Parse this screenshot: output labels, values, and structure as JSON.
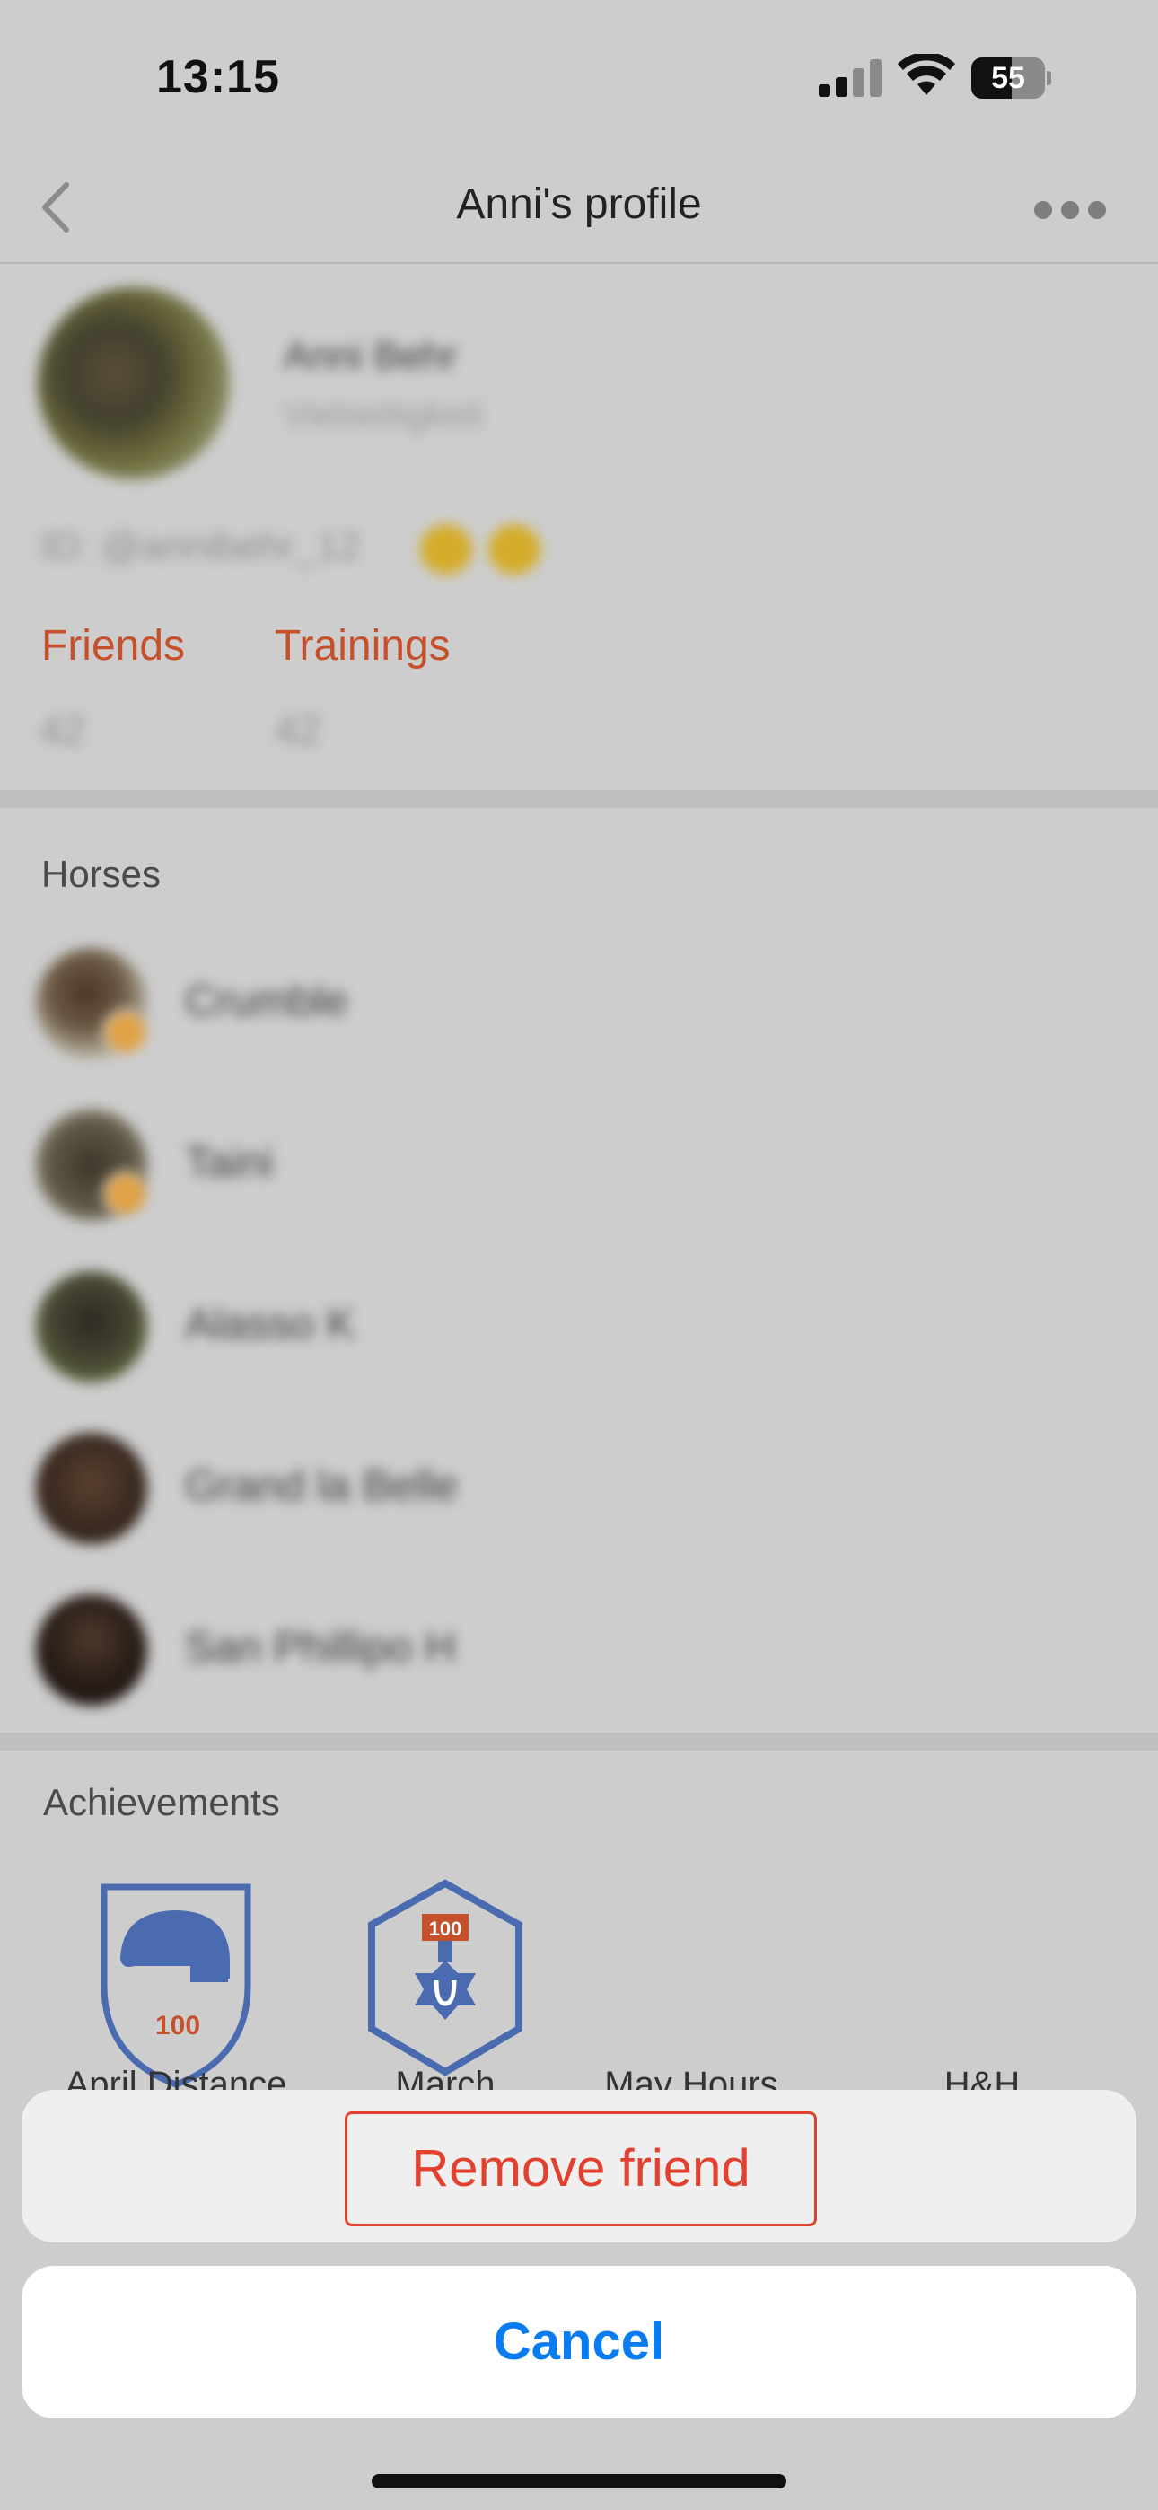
{
  "status_bar": {
    "time": "13:15",
    "battery_level": "55",
    "battery_fill_fraction": 0.55
  },
  "nav": {
    "title": "Anni's profile",
    "back_icon": "chevron-left-icon",
    "more_icon": "ellipsis-icon"
  },
  "profile": {
    "name": "Anni Behr",
    "subtitle": "Vielseitigkeit",
    "id_text": "ID: @annibehr_12",
    "stats": [
      {
        "label": "Friends",
        "value": "42"
      },
      {
        "label": "Trainings",
        "value": "42"
      }
    ]
  },
  "horses": {
    "title": "Horses",
    "items": [
      {
        "name": "Crumble"
      },
      {
        "name": "Taini"
      },
      {
        "name": "Alasso K"
      },
      {
        "name": "Grand la Belle"
      },
      {
        "name": "San Phillipo H"
      }
    ]
  },
  "achievements": {
    "title": "Achievements",
    "items": [
      {
        "label": "April Distance",
        "badge_text": "100"
      },
      {
        "label": "March",
        "badge_text": "100"
      },
      {
        "label": "May Hours"
      },
      {
        "label": "H&H"
      }
    ]
  },
  "action_sheet": {
    "remove_label": "Remove friend",
    "cancel_label": "Cancel"
  },
  "colors": {
    "accent_orange": "#c5502c",
    "destructive_red": "#e2412f",
    "ios_blue": "#0a7cf2",
    "badge_blue": "#4a6baf"
  }
}
